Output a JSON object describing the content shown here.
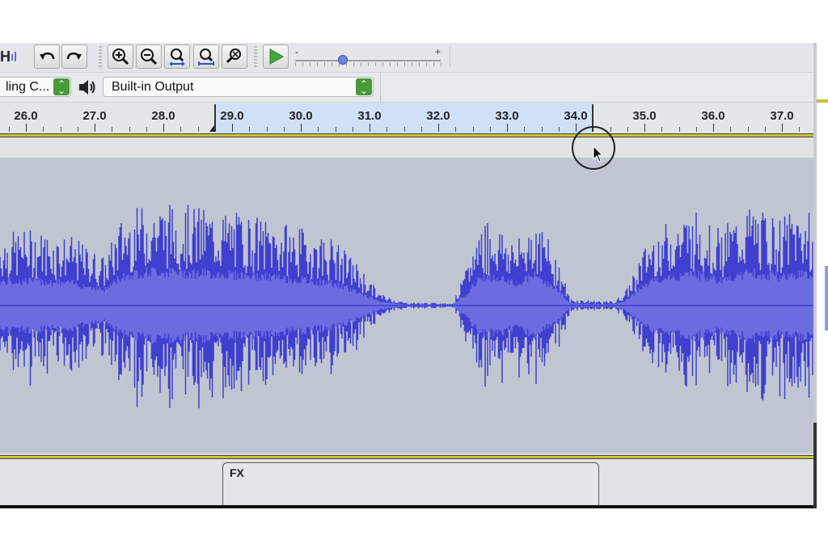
{
  "toolbar": {
    "hw_icon_text": "H",
    "buttons": [
      {
        "name": "undo",
        "icon": "undo-arrow-icon"
      },
      {
        "name": "redo",
        "icon": "redo-arrow-icon"
      },
      {
        "name": "zoom-in",
        "icon": "zoom-in-icon"
      },
      {
        "name": "zoom-out",
        "icon": "zoom-out-icon"
      },
      {
        "name": "fit-selection",
        "icon": "fit-selection-icon"
      },
      {
        "name": "fit-project",
        "icon": "fit-project-icon"
      },
      {
        "name": "zoom-toggle",
        "icon": "zoom-toggle-icon"
      },
      {
        "name": "play-at-speed",
        "icon": "play-icon"
      }
    ],
    "slider": {
      "min_label": "-",
      "max_label": "+",
      "value_fraction": 0.33
    }
  },
  "device_bar": {
    "recording_device": "ling C...",
    "output_device": "Built-in Output",
    "speaker_icon": "speaker-icon"
  },
  "ruler": {
    "ticks": [
      "26.0",
      "27.0",
      "28.0",
      "29.0",
      "30.0",
      "31.0",
      "32.0",
      "33.0",
      "34.0",
      "35.0",
      "36.0",
      "37.0"
    ],
    "selection_start": 28.75,
    "selection_end": 34.25
  },
  "track": {
    "effects_label": "FX",
    "waveform_color": "#3f3fd0",
    "waveform_rms_color": "#6a6ce0",
    "background_color": "#c0c6d1"
  },
  "colors": {
    "selection": "#cfe1f7",
    "track_border": "#c9c234",
    "play_green": "#3caa3c",
    "select_arrow_green": "#4a9a3a"
  }
}
